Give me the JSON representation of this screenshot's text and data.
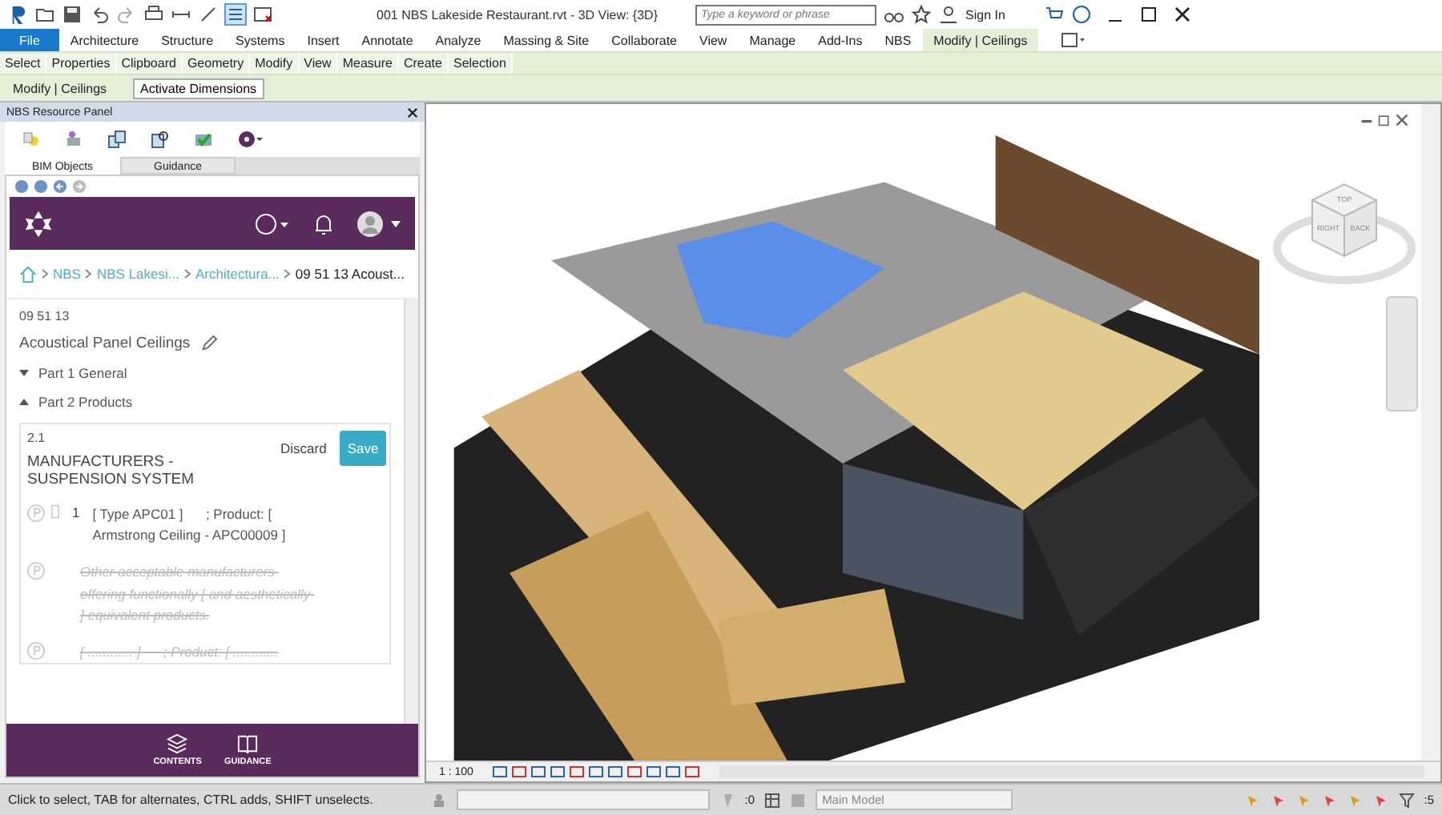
{
  "window": {
    "title": "001 NBS Lakeside Restaurant.rvt - 3D View: {3D}",
    "search_placeholder": "Type a keyword or phrase",
    "sign_in": "Sign In"
  },
  "ribbon_tabs": [
    {
      "label": "File",
      "selected": false,
      "kind": "file"
    },
    {
      "label": "Architecture",
      "selected": false,
      "kind": "tab"
    },
    {
      "label": "Structure",
      "selected": false,
      "kind": "tab"
    },
    {
      "label": "Systems",
      "selected": false,
      "kind": "tab"
    },
    {
      "label": "Insert",
      "selected": false,
      "kind": "tab"
    },
    {
      "label": "Annotate",
      "selected": false,
      "kind": "tab"
    },
    {
      "label": "Analyze",
      "selected": false,
      "kind": "tab"
    },
    {
      "label": "Massing & Site",
      "selected": false,
      "kind": "tab"
    },
    {
      "label": "Collaborate",
      "selected": false,
      "kind": "tab"
    },
    {
      "label": "View",
      "selected": false,
      "kind": "tab"
    },
    {
      "label": "Manage",
      "selected": false,
      "kind": "tab"
    },
    {
      "label": "Add-Ins",
      "selected": false,
      "kind": "tab"
    },
    {
      "label": "NBS",
      "selected": false,
      "kind": "tab"
    },
    {
      "label": "Modify | Ceilings",
      "selected": true,
      "kind": "tab"
    }
  ],
  "ribbon_panels": [
    "Select",
    "Properties",
    "Clipboard",
    "Geometry",
    "Modify",
    "View",
    "Measure",
    "Create",
    "Selection"
  ],
  "context_bar": {
    "label": "Modify | Ceilings",
    "button": "Activate Dimensions"
  },
  "panel": {
    "title": "NBS Resource Panel",
    "tabs": [
      {
        "label": "BIM Objects",
        "selected": true
      },
      {
        "label": "Guidance",
        "selected": false
      }
    ],
    "breadcrumb": [
      {
        "label": "NBS",
        "kind": "link"
      },
      {
        "label": "NBS Lakesi...",
        "kind": "link"
      },
      {
        "label": "Architectura...",
        "kind": "link"
      },
      {
        "label": "09 51 13 Acoust...",
        "kind": "current"
      }
    ],
    "section_code": "09 51 13",
    "section_title": "Acoustical Panel Ceilings",
    "parts": [
      {
        "label": "Part 1 General",
        "expanded": false
      },
      {
        "label": "Part 2 Products",
        "expanded": true
      }
    ],
    "clause": {
      "number": "2.1",
      "title": "MANUFACTURERS - SUSPENSION SYSTEM",
      "discard": "Discard",
      "save": "Save",
      "items": [
        {
          "number": "1",
          "text": "[ Type APC01 ]      ; Product: [ Armstrong Ceiling - APC00009 ]",
          "struck": false
        },
        {
          "text": "Other acceptable manufacturers offering functionally [ and aesthetically ] equivalent products.",
          "struck": true
        },
        {
          "text": "[ ............ ]      ; Product: [ ............",
          "struck": true
        }
      ]
    },
    "footer": [
      "CONTENTS",
      "GUIDANCE"
    ]
  },
  "view": {
    "scale": "1 : 100",
    "cube_faces": [
      "TOP",
      "RIGHT",
      "BACK"
    ]
  },
  "status_bar": {
    "message": "Click to select, TAB for alternates, CTRL adds, SHIFT unselects.",
    "count": ":0",
    "model": "Main Model",
    "filter_count": ":5"
  }
}
